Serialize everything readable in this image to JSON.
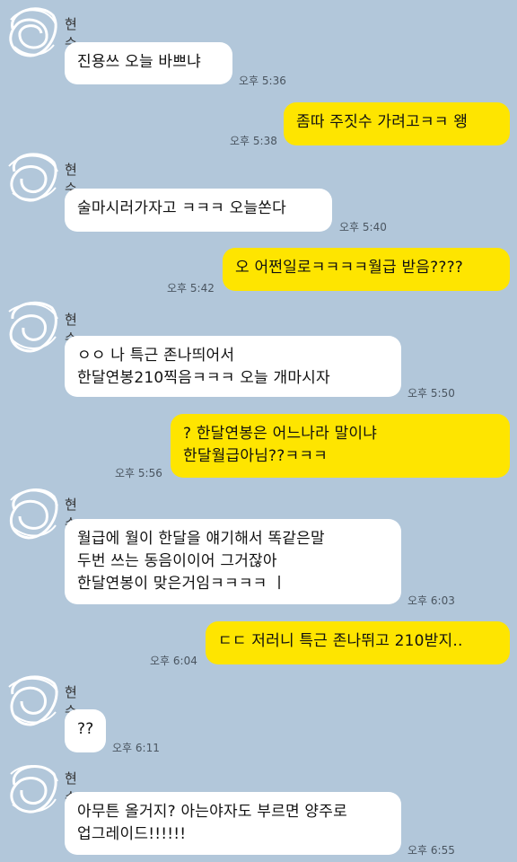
{
  "chat": {
    "messages": [
      {
        "sender": "현수",
        "text": "진용쓰 오늘 바쁘냐",
        "time": "오후 5:36"
      },
      {
        "text": "좀따 주짓수 가려고ㅋㅋ 왱",
        "time": "오후 5:38"
      },
      {
        "sender": "현수",
        "text": "술마시러가자고 ㅋㅋㅋ 오늘쏜다",
        "time": "오후 5:40"
      },
      {
        "text": "오 어쩐일로ㅋㅋㅋㅋ월급 받음????",
        "time": "오후 5:42"
      },
      {
        "sender": "현수",
        "text": "ㅇㅇ 나 특근 존나띄어서\n한달연봉210찍음ㅋㅋㅋ 오늘 개마시자",
        "time": "오후 5:50"
      },
      {
        "text": "? 한달연봉은 어느나라 말이냐\n한달월급아님??ㅋㅋㅋ",
        "time": "오후 5:56"
      },
      {
        "sender": "현수",
        "text": "월급에 월이 한달을 얘기해서 똑같은말\n두번 쓰는 동음이이어 그거잖아\n한달연봉이 맞은거임ㅋㅋㅋㅋ ㅣ",
        "time": "오후 6:03"
      },
      {
        "text": "ㄷㄷ 저러니 특근 존나뛰고 210받지..",
        "time": "오후 6:04"
      },
      {
        "sender": "현수",
        "text": "??",
        "time": "오후 6:11"
      },
      {
        "sender": "현수",
        "text": "아무튼 올거지? 아는야자도 부르면 양주로\n업그레이드!!!!!!",
        "time": "오후 6:55"
      }
    ]
  },
  "colors": {
    "background": "#b2c7da",
    "my_bubble": "#fee500",
    "their_bubble": "#ffffff"
  },
  "icons": {
    "avatar": "scribbled-avatar-icon"
  }
}
